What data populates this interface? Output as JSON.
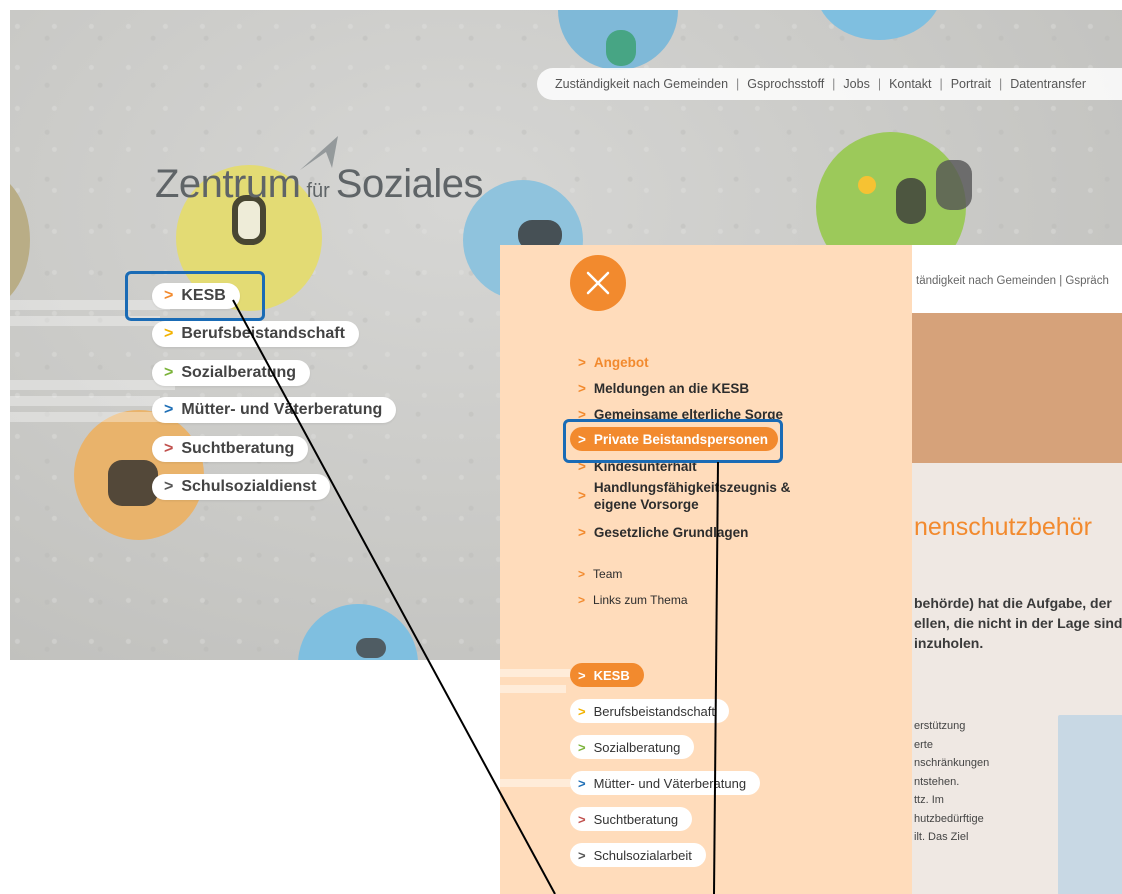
{
  "top_nav": {
    "links": [
      "Zuständigkeit nach Gemeinden",
      "Gsprochsstoff",
      "Jobs",
      "Kontakt",
      "Portrait",
      "Datentransfer"
    ],
    "separator": "|"
  },
  "logo": {
    "part1": "Zentrum",
    "part2": "für",
    "part3": "Soziales"
  },
  "left_menu": {
    "items": [
      {
        "label": "KESB",
        "chev_color": "#f28a2e"
      },
      {
        "label": "Berufsbeistandschaft",
        "chev_color": "#f2b200"
      },
      {
        "label": "Sozialberatung",
        "chev_color": "#7bb33a"
      },
      {
        "label": "Mütter- und Väterberatung",
        "chev_color": "#1f6fb6"
      },
      {
        "label": "Suchtberatung",
        "chev_color": "#c0504d"
      },
      {
        "label": "Schulsozialdienst",
        "chev_color": "#555555"
      }
    ]
  },
  "overlay_menu": {
    "close_icon": "close-icon",
    "items": [
      {
        "label": "Angebot",
        "style": "orange"
      },
      {
        "label": "Meldungen an die KESB",
        "style": "bold"
      },
      {
        "label": "Gemeinsame elterliche Sorge",
        "style": "bold"
      },
      {
        "label": "Private Beistandspersonen",
        "style": "active"
      },
      {
        "label": "Kindesunterhalt",
        "style": "bold"
      },
      {
        "label": "Handlungsfähigkeitszeugnis &",
        "label2": "eigene Vorsorge",
        "style": "bold"
      },
      {
        "label": "Gesetzliche Grundlagen",
        "style": "bold"
      },
      {
        "label": "Team",
        "style": "small"
      },
      {
        "label": "Links zum Thema",
        "style": "small"
      }
    ],
    "bottom_items": [
      {
        "label": "KESB",
        "chev_color": "#ffffff"
      },
      {
        "label": "Berufsbeistandschaft",
        "chev_color": "#f2b200"
      },
      {
        "label": "Sozialberatung",
        "chev_color": "#7bb33a"
      },
      {
        "label": "Mütter- und Väterberatung",
        "chev_color": "#1f6fb6"
      },
      {
        "label": "Suchtberatung",
        "chev_color": "#c0504d"
      },
      {
        "label": "Schulsozialarbeit",
        "chev_color": "#555555"
      }
    ]
  },
  "right_page": {
    "top_text": "tändigkeit nach Gemeinden  |  Gspräch",
    "heading": "nenschutzbehör",
    "para": [
      "behörde) hat die Aufgabe, der",
      "ellen, die nicht in der Lage sind",
      "inzuholen."
    ],
    "small": [
      "erstützung",
      "erte",
      "nschränkungen",
      "",
      "ntstehen.",
      "",
      "ttz. Im",
      "hutzbedürftige",
      "ilt. Das Ziel"
    ]
  },
  "colors": {
    "accent": "#f28a2e",
    "highlight": "#1a6bb5",
    "overlay_bg": "#ffdcbb"
  }
}
